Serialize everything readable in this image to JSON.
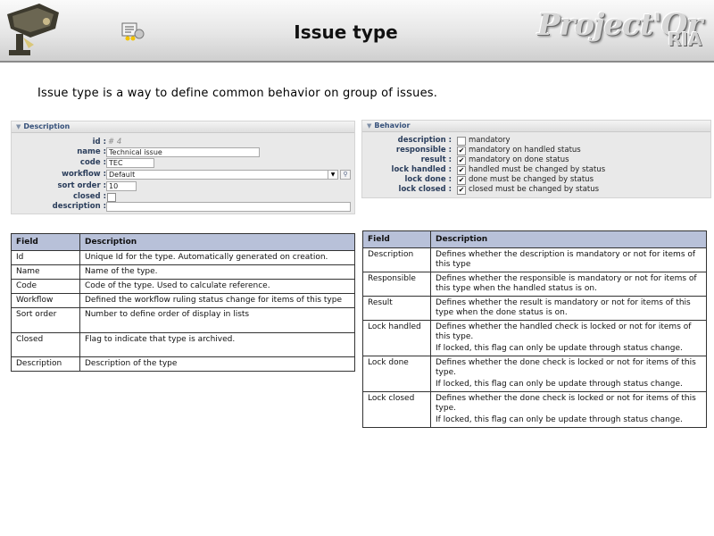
{
  "header": {
    "title": "Issue type",
    "brand": "Project'Or",
    "brand_suffix": "RIA"
  },
  "intro": "Issue type is a way to define common behavior on group of issues.",
  "description_panel": {
    "title": "Description",
    "fields": {
      "id_label": "id :",
      "id_value": "# 4",
      "name_label": "name :",
      "name_value": "Technical issue",
      "code_label": "code :",
      "code_value": "TEC",
      "workflow_label": "workflow :",
      "workflow_value": "Default",
      "sort_label": "sort order :",
      "sort_value": "10",
      "closed_label": "closed :",
      "desc_label": "description :",
      "desc_value": ""
    }
  },
  "behavior_panel": {
    "title": "Behavior",
    "rows": [
      {
        "label": "description :",
        "checked": false,
        "text": "mandatory"
      },
      {
        "label": "responsible :",
        "checked": true,
        "text": "mandatory on handled status"
      },
      {
        "label": "result :",
        "checked": true,
        "text": "mandatory on done status"
      },
      {
        "label": "lock handled :",
        "checked": true,
        "text": "handled must be changed by status"
      },
      {
        "label": "lock done :",
        "checked": true,
        "text": "done must be changed by status"
      },
      {
        "label": "lock closed :",
        "checked": true,
        "text": "closed must be changed by status"
      }
    ]
  },
  "left_table": {
    "headers": [
      "Field",
      "Description"
    ],
    "rows": [
      [
        "Id",
        "Unique Id for the type. Automatically generated on creation."
      ],
      [
        "Name",
        "Name of the type."
      ],
      [
        "Code",
        "Code of the type. Used to calculate reference."
      ],
      [
        "Workflow",
        "Defined the workflow ruling status change for items of this type"
      ],
      [
        "Sort order",
        "Number to define order of display in lists"
      ],
      [
        "Closed",
        "Flag to indicate that type is archived."
      ],
      [
        "Description",
        "Description of the type"
      ]
    ]
  },
  "right_table": {
    "headers": [
      "Field",
      "Description"
    ],
    "rows": [
      {
        "field": "Description",
        "desc": "Defines whether the description is mandatory or not for items of this type",
        "note": ""
      },
      {
        "field": "Responsible",
        "desc": "Defines whether the responsible is mandatory or not for items of this type when the handled status is on.",
        "note": ""
      },
      {
        "field": "Result",
        "desc": "Defines whether the result is mandatory or not for items of this type when the done status is on.",
        "note": ""
      },
      {
        "field": "Lock handled",
        "desc": "Defines whether the handled check is locked or not for items of this type.",
        "note": "If locked, this flag can only be update through status change."
      },
      {
        "field": "Lock done",
        "desc": "Defines whether the done check is locked or not for items of this type.",
        "note": "If locked, this flag can only be update through status change."
      },
      {
        "field": "Lock closed",
        "desc": "Defines whether the done check is locked or not for items of this type.",
        "note": "If locked, this flag can only be update through status change."
      }
    ]
  }
}
